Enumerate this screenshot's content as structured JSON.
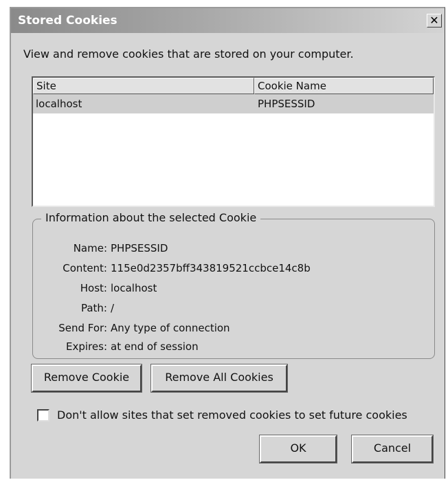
{
  "window": {
    "title": "Stored Cookies",
    "close_glyph": "✕"
  },
  "description": "View and remove cookies that are stored on your computer.",
  "cookie_list": {
    "columns": [
      "Site",
      "Cookie Name"
    ],
    "rows": [
      {
        "site": "localhost",
        "cookie_name": "PHPSESSID"
      }
    ]
  },
  "info": {
    "legend": "Information about the selected Cookie",
    "fields": [
      {
        "label": "Name:",
        "value": "PHPSESSID"
      },
      {
        "label": "Content:",
        "value": "115e0d2357bff343819521ccbce14c8b"
      },
      {
        "label": "Host:",
        "value": "localhost"
      },
      {
        "label": "Path:",
        "value": "/"
      },
      {
        "label": "Send For:",
        "value": "Any type of connection"
      },
      {
        "label": "Expires:",
        "value": "at end of session"
      }
    ]
  },
  "buttons": {
    "remove_cookie": "Remove Cookie",
    "remove_all": "Remove All Cookies",
    "ok": "OK",
    "cancel": "Cancel"
  },
  "checkbox": {
    "label": "Don't allow sites that set removed cookies to set future cookies",
    "checked": false
  }
}
